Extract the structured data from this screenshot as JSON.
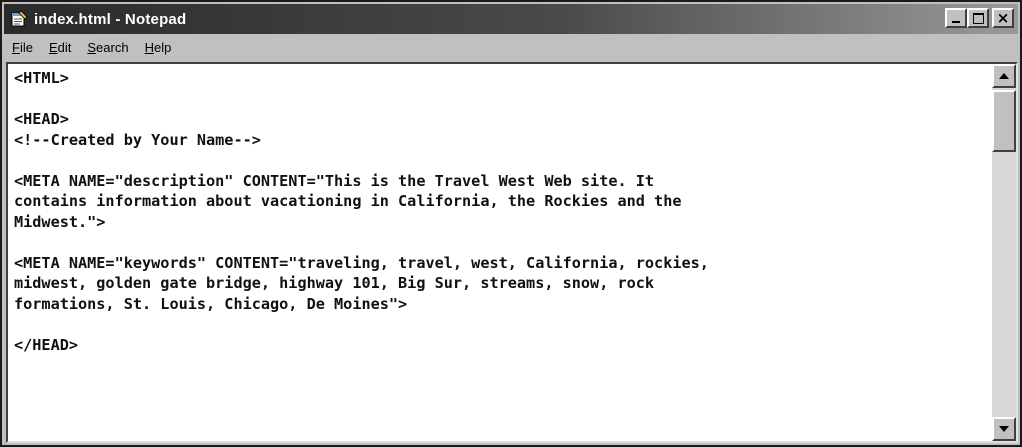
{
  "window": {
    "title": "index.html - Notepad",
    "icon": "notepad-icon",
    "buttons": {
      "minimize": "_",
      "maximize": "□",
      "close": "×"
    }
  },
  "menu": [
    {
      "label": "File",
      "underline": "F",
      "rest": "ile"
    },
    {
      "label": "Edit",
      "underline": "E",
      "rest": "dit"
    },
    {
      "label": "Search",
      "underline": "S",
      "rest": "earch"
    },
    {
      "label": "Help",
      "underline": "H",
      "rest": "elp"
    }
  ],
  "editor": {
    "content": "<HTML>\n\n<HEAD>\n<!--Created by Your Name-->\n\n<META NAME=\"description\" CONTENT=\"This is the Travel West Web site. It\ncontains information about vacationing in California, the Rockies and the\nMidwest.\">\n\n<META NAME=\"keywords\" CONTENT=\"traveling, travel, west, California, rockies,\nmidwest, golden gate bridge, highway 101, Big Sur, streams, snow, rock\nformations, St. Louis, Chicago, De Moines\">\n\n</HEAD>"
  },
  "scrollbar": {
    "up_icon": "arrow-up-icon",
    "down_icon": "arrow-down-icon"
  }
}
